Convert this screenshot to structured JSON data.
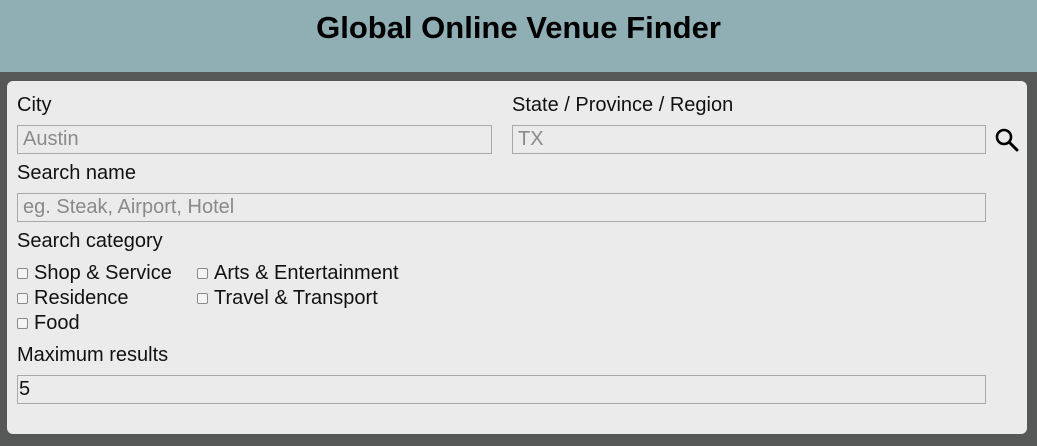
{
  "header": {
    "title": "Global Online Venue Finder"
  },
  "form": {
    "city": {
      "label": "City",
      "placeholder": "Austin",
      "value": ""
    },
    "region": {
      "label": "State / Province / Region",
      "placeholder": "TX",
      "value": ""
    },
    "search_button": {
      "icon": "search-icon"
    },
    "search_name": {
      "label": "Search name",
      "placeholder": "eg. Steak, Airport, Hotel",
      "value": ""
    },
    "category": {
      "label": "Search category",
      "options": [
        {
          "label": "Shop & Service",
          "checked": false
        },
        {
          "label": "Arts & Entertainment",
          "checked": false
        },
        {
          "label": "Residence",
          "checked": false
        },
        {
          "label": "Travel & Transport",
          "checked": false
        },
        {
          "label": "Food",
          "checked": false
        }
      ]
    },
    "max_results": {
      "label": "Maximum results",
      "value": "5"
    }
  }
}
